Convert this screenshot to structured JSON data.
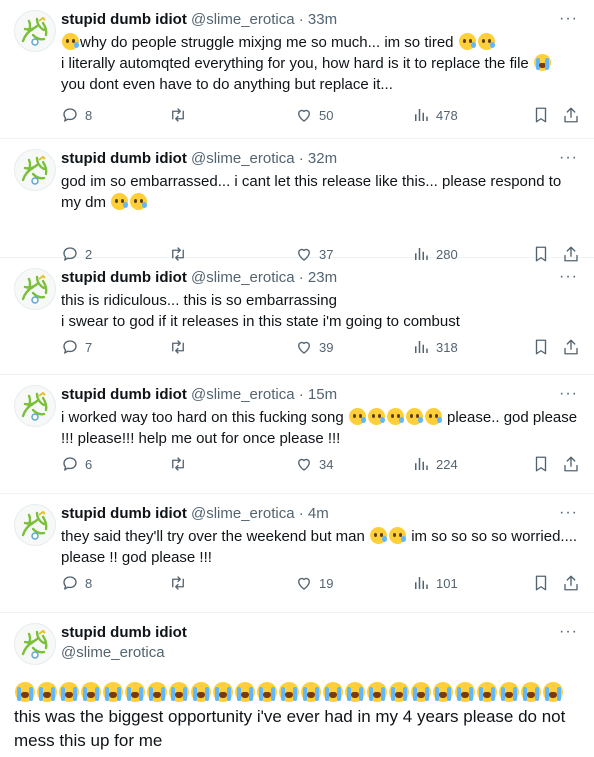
{
  "author": {
    "name": "stupid dumb idiot",
    "handle": "@slime_erotica",
    "separator": "·"
  },
  "tweets": [
    {
      "time": "33m",
      "lines": [
        [
          {
            "e": "worry"
          },
          {
            "t": "why do people struggle mixjng me so much... im so tired "
          },
          {
            "e": "worry"
          },
          {
            "e": "worry"
          }
        ],
        [
          {
            "t": "i literally automqted everything for you, how hard is it to replace the file "
          },
          {
            "e": "cry"
          }
        ],
        [
          {
            "t": "you dont even have to do anything but replace it..."
          }
        ]
      ],
      "stats": {
        "replies": "8",
        "likes": "50",
        "views": "478"
      }
    },
    {
      "time": "32m",
      "lines": [
        [
          {
            "t": "god im so embarrassed... i cant let this release like this... please respond to my dm "
          },
          {
            "e": "worry"
          },
          {
            "e": "worry"
          }
        ]
      ],
      "stats": {
        "replies": "2",
        "likes": "37",
        "views": "280"
      }
    },
    {
      "time": "23m",
      "lines": [
        [
          {
            "t": "this is ridiculous... this is so embarrassing"
          }
        ],
        [
          {
            "t": "i swear to god if it releases in this state i'm going to combust"
          }
        ]
      ],
      "stats": {
        "replies": "7",
        "likes": "39",
        "views": "318"
      }
    },
    {
      "time": "15m",
      "lines": [
        [
          {
            "t": "i worked way too hard on this fucking song "
          },
          {
            "e": "worry"
          },
          {
            "e": "worry"
          },
          {
            "e": "worry"
          },
          {
            "e": "worry"
          },
          {
            "e": "worry"
          },
          {
            "t": " please.. god please !!! please!!! help me out for once please !!!"
          }
        ]
      ],
      "stats": {
        "replies": "6",
        "likes": "34",
        "views": "224"
      }
    },
    {
      "time": "4m",
      "lines": [
        [
          {
            "t": "they said they'll try over the weekend but man "
          },
          {
            "e": "worry"
          },
          {
            "e": "worry"
          },
          {
            "t": " im so so so so worried.... please !! god please !!!"
          }
        ]
      ],
      "stats": {
        "replies": "8",
        "likes": "19",
        "views": "101"
      }
    }
  ],
  "final": {
    "cry_count": 25,
    "text": " this was the biggest opportunity i've ever had in my 4 years please do not mess this up for me"
  },
  "icons": {
    "reply": "reply-icon",
    "retweet": "retweet-icon",
    "like": "heart-icon",
    "views": "views-icon",
    "bookmark": "bookmark-icon",
    "share": "share-icon",
    "more": "more-icon",
    "avatar": "avatar-image"
  },
  "colors": {
    "secondary": "#536471",
    "emoji_face": "#ffcf3a",
    "tear": "#5fb7ff",
    "divider": "#eff3f4"
  }
}
